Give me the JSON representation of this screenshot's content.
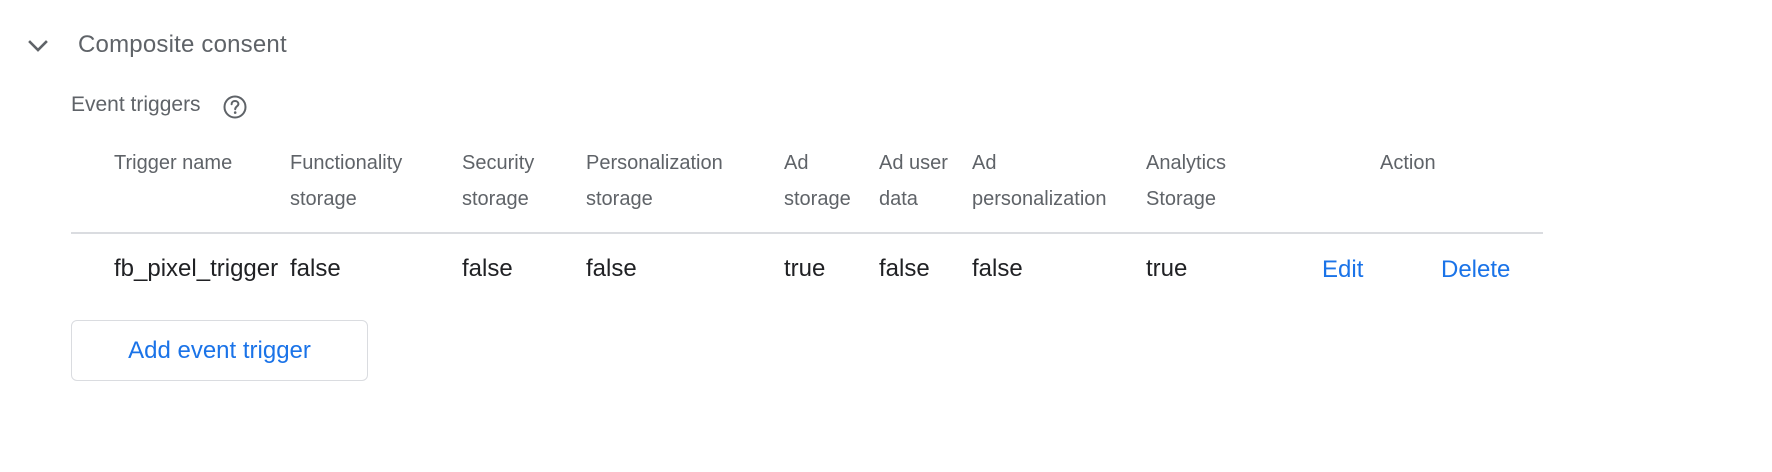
{
  "section": {
    "title": "Composite consent",
    "chevron_icon": "chevron-down-icon"
  },
  "event_triggers": {
    "label": "Event triggers",
    "help_icon": "help-circle-icon",
    "columns": [
      "Trigger name",
      "Functionality\nstorage",
      "Security\nstorage",
      "Personalization\nstorage",
      "Ad\nstorage",
      "Ad user\ndata",
      "Ad\npersonalization",
      "Analytics\nStorage",
      "Action"
    ],
    "rows": [
      {
        "trigger_name": "fb_pixel_trigger",
        "functionality_storage": "false",
        "security_storage": "false",
        "personalization_storage": "false",
        "ad_storage": "true",
        "ad_user_data": "false",
        "ad_personalization": "false",
        "analytics_storage": "true",
        "edit_label": "Edit",
        "delete_label": "Delete"
      }
    ],
    "add_button_label": "Add event trigger"
  },
  "colors": {
    "link": "#1a73e8",
    "secondary_text": "#5f6368",
    "primary_text": "#202124",
    "divider": "#dadce0"
  }
}
